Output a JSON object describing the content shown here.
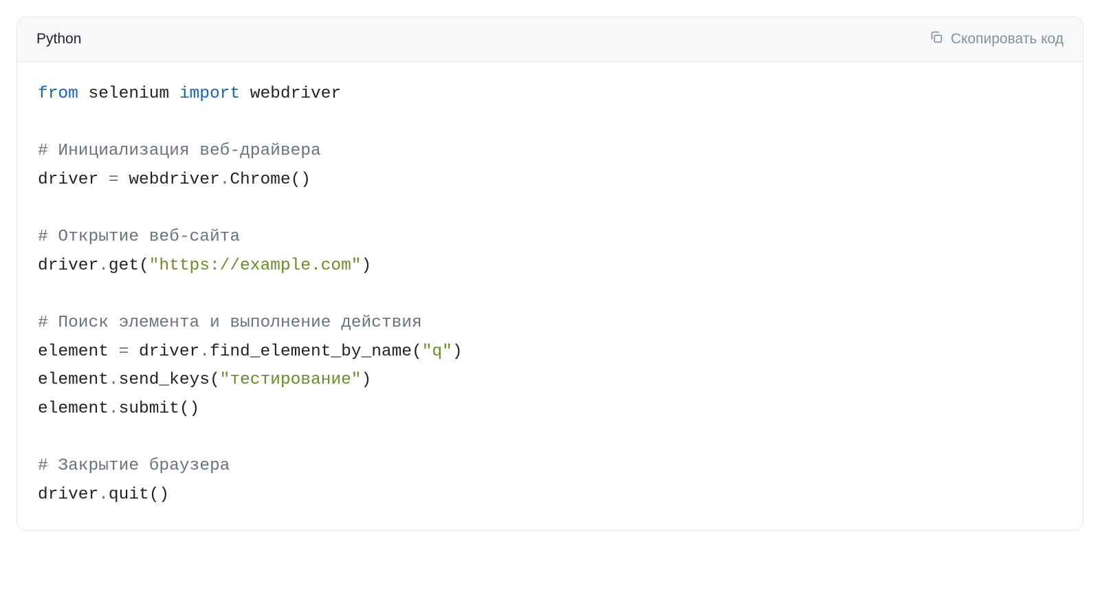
{
  "header": {
    "language": "Python",
    "copy_label": "Скопировать код"
  },
  "code": {
    "tokens": [
      {
        "cls": "tok-kw",
        "text": "from"
      },
      {
        "cls": "tok-pn",
        "text": " selenium "
      },
      {
        "cls": "tok-kw",
        "text": "import"
      },
      {
        "cls": "tok-pn",
        "text": " webdriver\n\n"
      },
      {
        "cls": "tok-cm",
        "text": "# Инициализация веб-драйвера"
      },
      {
        "cls": "tok-pn",
        "text": "\ndriver "
      },
      {
        "cls": "tok-op",
        "text": "="
      },
      {
        "cls": "tok-pn",
        "text": " webdriver"
      },
      {
        "cls": "tok-op",
        "text": "."
      },
      {
        "cls": "tok-pn",
        "text": "Chrome()\n\n"
      },
      {
        "cls": "tok-cm",
        "text": "# Открытие веб-сайта"
      },
      {
        "cls": "tok-pn",
        "text": "\ndriver"
      },
      {
        "cls": "tok-op",
        "text": "."
      },
      {
        "cls": "tok-pn",
        "text": "get("
      },
      {
        "cls": "tok-str",
        "text": "\"https://example.com\""
      },
      {
        "cls": "tok-pn",
        "text": ")\n\n"
      },
      {
        "cls": "tok-cm",
        "text": "# Поиск элемента и выполнение действия"
      },
      {
        "cls": "tok-pn",
        "text": "\nelement "
      },
      {
        "cls": "tok-op",
        "text": "="
      },
      {
        "cls": "tok-pn",
        "text": " driver"
      },
      {
        "cls": "tok-op",
        "text": "."
      },
      {
        "cls": "tok-pn",
        "text": "find_element_by_name("
      },
      {
        "cls": "tok-str",
        "text": "\"q\""
      },
      {
        "cls": "tok-pn",
        "text": ")\nelement"
      },
      {
        "cls": "tok-op",
        "text": "."
      },
      {
        "cls": "tok-pn",
        "text": "send_keys("
      },
      {
        "cls": "tok-str",
        "text": "\"тестирование\""
      },
      {
        "cls": "tok-pn",
        "text": ")\nelement"
      },
      {
        "cls": "tok-op",
        "text": "."
      },
      {
        "cls": "tok-pn",
        "text": "submit()\n\n"
      },
      {
        "cls": "tok-cm",
        "text": "# Закрытие браузера"
      },
      {
        "cls": "tok-pn",
        "text": "\ndriver"
      },
      {
        "cls": "tok-op",
        "text": "."
      },
      {
        "cls": "tok-pn",
        "text": "quit()"
      }
    ]
  }
}
